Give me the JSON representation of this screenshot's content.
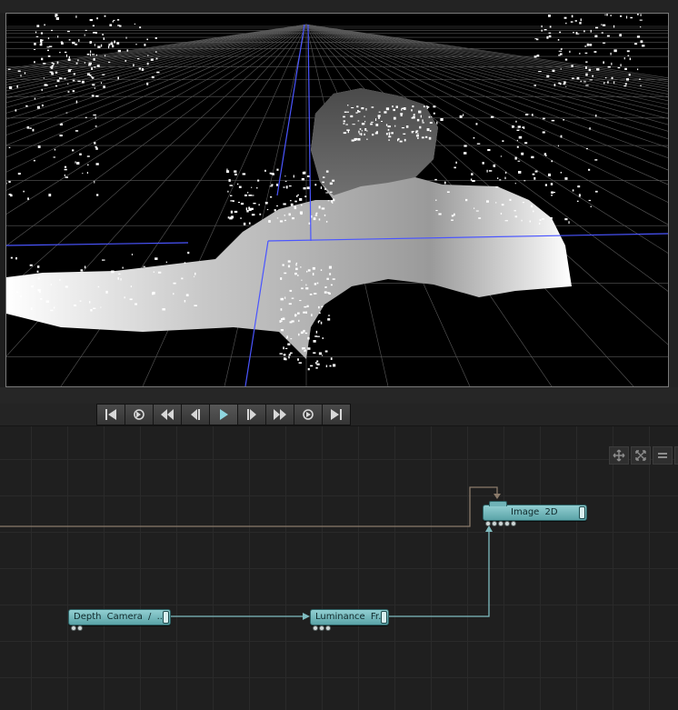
{
  "viewport": {
    "description_icon": "depth-camera-preview"
  },
  "transport": {
    "buttons": [
      {
        "name": "skip-to-start-button",
        "icon": "skip-start-icon"
      },
      {
        "name": "loop-button",
        "icon": "loop-icon"
      },
      {
        "name": "rewind-button",
        "icon": "rewind-icon"
      },
      {
        "name": "step-back-button",
        "icon": "step-back-icon"
      },
      {
        "name": "play-button",
        "icon": "play-icon"
      },
      {
        "name": "step-forward-button",
        "icon": "step-forward-icon"
      },
      {
        "name": "fast-forward-button",
        "icon": "fast-forward-icon"
      },
      {
        "name": "record-button",
        "icon": "circle-icon"
      },
      {
        "name": "skip-to-end-button",
        "icon": "skip-end-icon"
      }
    ]
  },
  "graph_tools": [
    "move-icon",
    "fit-icon",
    "align-icon",
    "add-icon"
  ],
  "nodes": {
    "depth_camera": {
      "label": "Depth Camera / ..."
    },
    "luminance": {
      "label": "Luminance Fr..."
    },
    "image2d": {
      "label": "Image 2D"
    }
  },
  "colors": {
    "node_fill": "#7fc2c5",
    "wire": "#7fbcc0",
    "wire_brown": "#8a7a6a",
    "grid_blue": "#4a55ff"
  }
}
